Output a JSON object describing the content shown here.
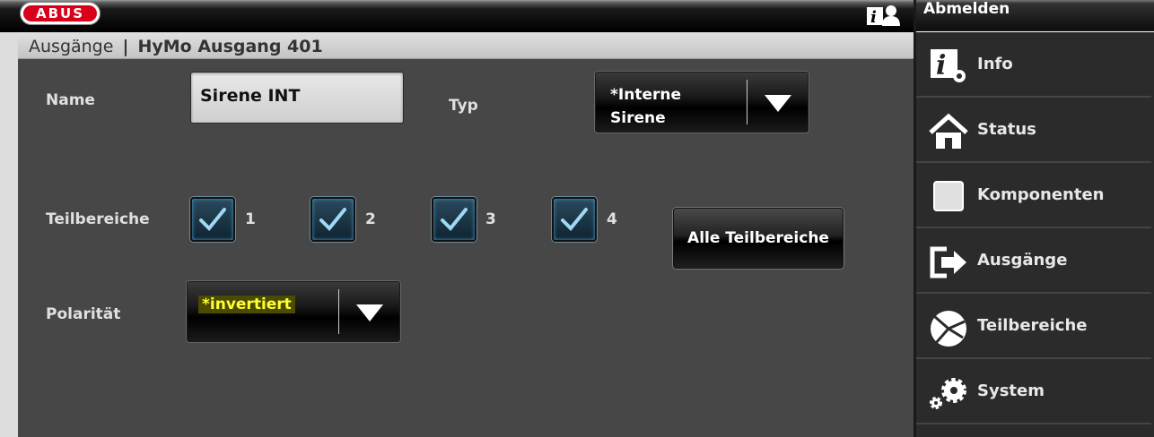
{
  "header": {
    "logo_text": "ABUS"
  },
  "breadcrumb": {
    "section": "Ausgänge",
    "separator": "|",
    "title": "HyMo Ausgang 401"
  },
  "form": {
    "name_label": "Name",
    "name_value": "Sirene INT",
    "typ_label": "Typ",
    "typ_value_line1": "*Interne",
    "typ_value_line2": "Sirene",
    "teilbereiche_label": "Teilbereiche",
    "checkboxes": [
      {
        "label": "1",
        "checked": true
      },
      {
        "label": "2",
        "checked": true
      },
      {
        "label": "3",
        "checked": true
      },
      {
        "label": "4",
        "checked": true
      }
    ],
    "all_button": "Alle Teilbereiche",
    "polaritaet_label": "Polarität",
    "polaritaet_value": "*invertiert"
  },
  "sidebar": {
    "logout": "Abmelden",
    "items": [
      {
        "label": "Info",
        "icon": "info-gear-icon"
      },
      {
        "label": "Status",
        "icon": "home-icon"
      },
      {
        "label": "Komponenten",
        "icon": "square-icon"
      },
      {
        "label": "Ausgänge",
        "icon": "exit-arrow-icon"
      },
      {
        "label": "Teilbereiche",
        "icon": "pie-sections-icon"
      },
      {
        "label": "System",
        "icon": "gears-icon"
      }
    ]
  },
  "colors": {
    "brand_red": "#d9001b",
    "panel_bg": "#474747",
    "highlight_text": "#ffff33"
  }
}
